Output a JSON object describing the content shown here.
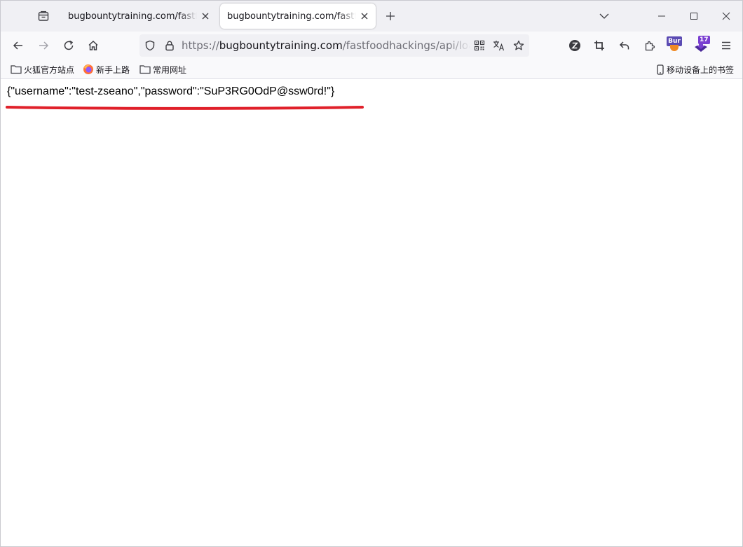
{
  "tabs": [
    {
      "title": "bugbountytraining.com/fastfoodhackings/api/loader.php",
      "active": false
    },
    {
      "title": "bugbountytraining.com/fastfoodhackings/api/loader.php",
      "active": true
    }
  ],
  "url": {
    "scheme": "https://",
    "domain": "bugbountytraining.com",
    "path": "/fastfoodhackings/api/loader.php"
  },
  "toolbar": {
    "burp_badge": "Bur",
    "extension_count": "17"
  },
  "bookmarks": [
    {
      "label": "火狐官方站点",
      "icon": "folder-icon"
    },
    {
      "label": "新手上路",
      "icon": "firefox-icon"
    },
    {
      "label": "常用网址",
      "icon": "folder-icon"
    }
  ],
  "mobile_bookmarks": "移动设备上的书签",
  "page": {
    "json_text": "{\"username\":\"test-zseano\",\"password\":\"SuP3RG0OdP@ssw0rd!\"}"
  },
  "colors": {
    "accent": "#0060df",
    "annotation": "#e0202a",
    "tabstrip": "#f0f0f4",
    "toolbar": "#f9f9fb"
  }
}
